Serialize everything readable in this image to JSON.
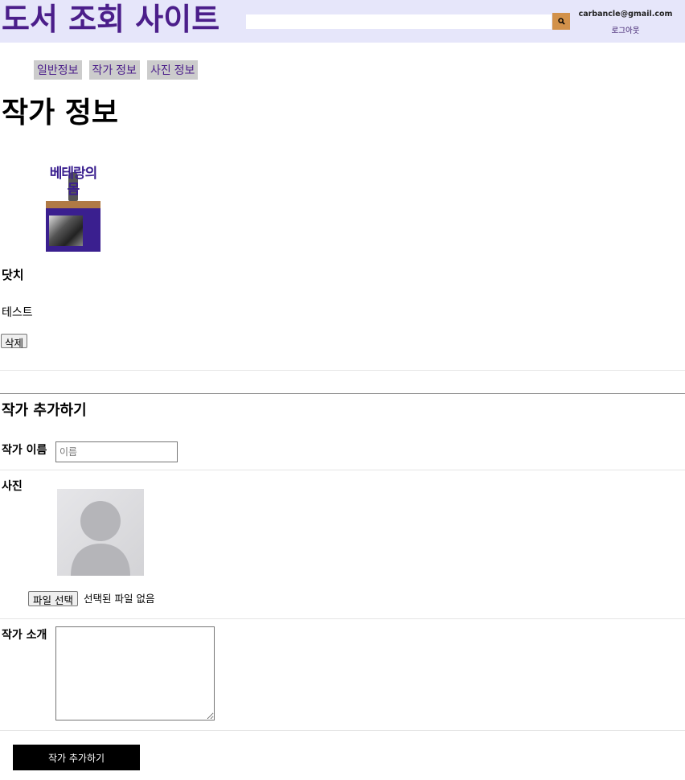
{
  "header": {
    "site_title": "도서 조회 사이트",
    "search": {
      "value": "",
      "placeholder": ""
    },
    "search_icon": "search-icon",
    "user_email": "carbancle@gmail.com",
    "logout_label": "로그아웃"
  },
  "tabs": [
    {
      "label": "일반정보"
    },
    {
      "label": "작가 정보"
    },
    {
      "label": "사진 정보"
    }
  ],
  "page_title": "작가 정보",
  "book_cover": {
    "title_text": "베테랑의 몸"
  },
  "author": {
    "name": "닷치",
    "description": "테스트",
    "delete_label": "삭제"
  },
  "form": {
    "title": "작가 추가하기",
    "name_label": "작가 이름",
    "name_placeholder": "이름",
    "photo_label": "사진",
    "file_button_label": "파일 선택",
    "file_status": "선택된 파일 없음",
    "intro_label": "작가 소개",
    "intro_value": "",
    "submit_label": "작가 추가하기"
  },
  "colors": {
    "header_bg": "#e6e6fa",
    "brand": "#4b1e8a",
    "search_button": "#d2914a",
    "tab_bg": "#cccccc",
    "submit_bg": "#000000"
  }
}
